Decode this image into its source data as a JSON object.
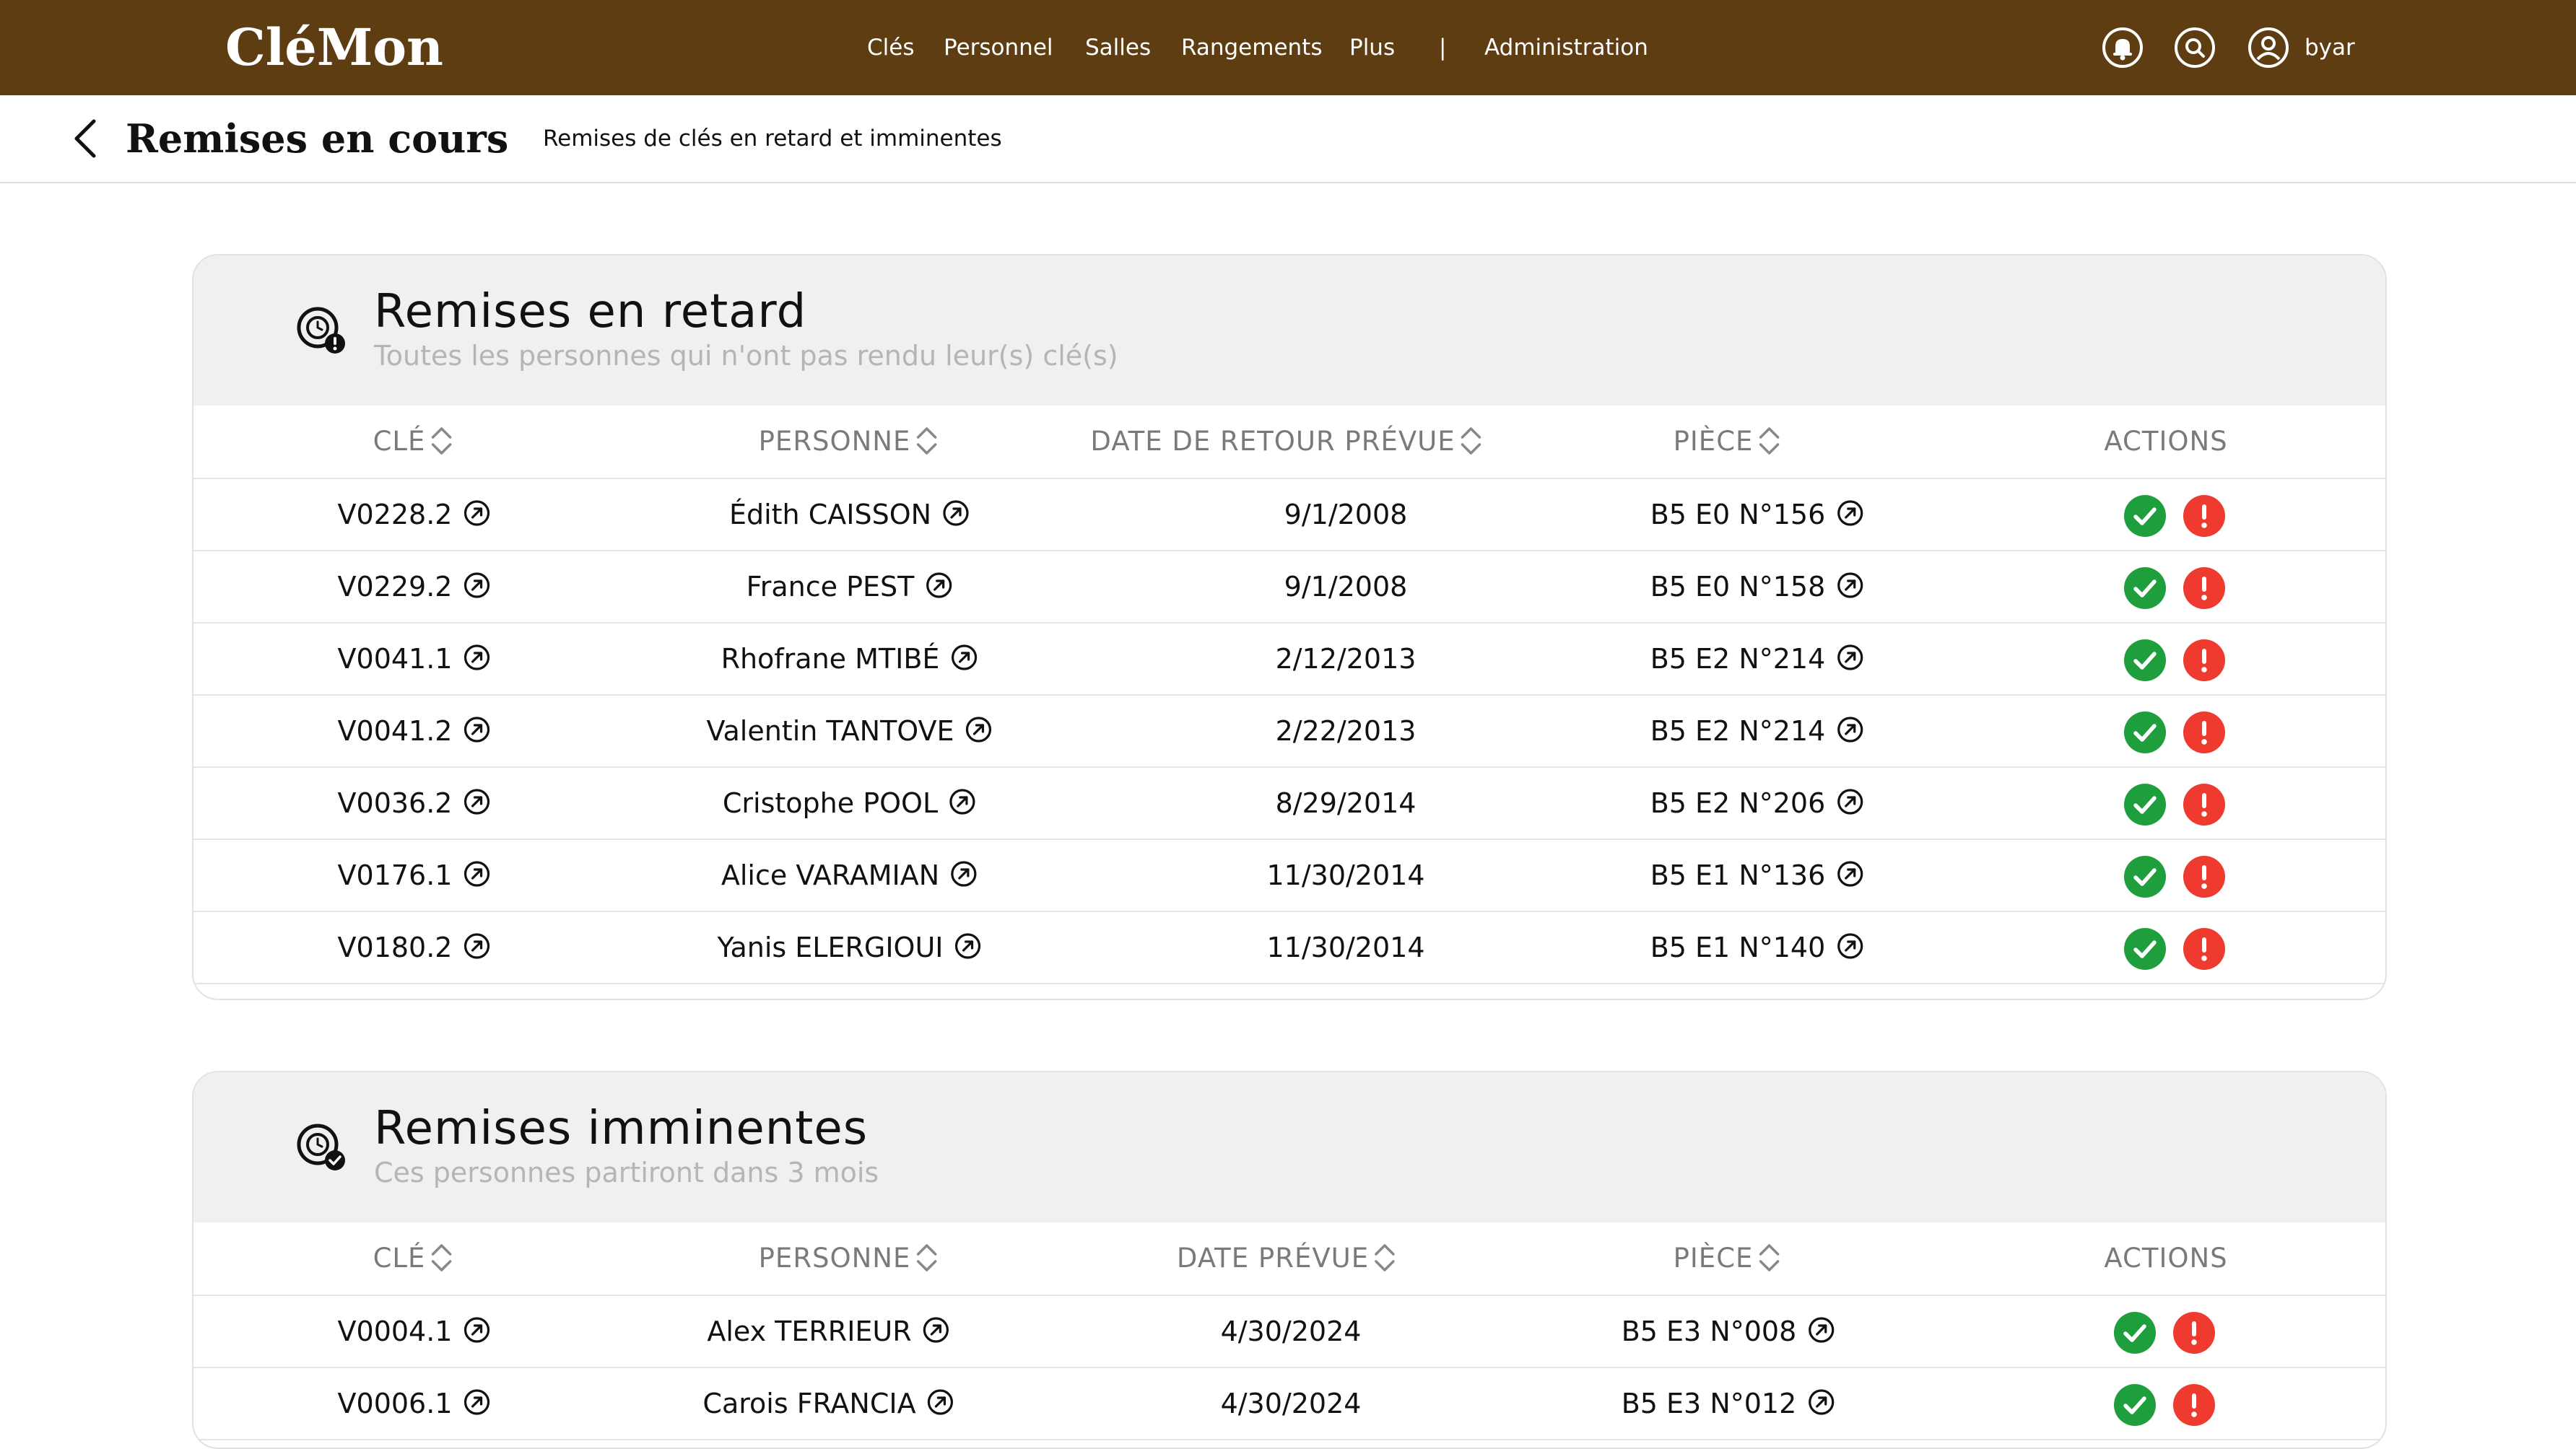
{
  "app": {
    "brand": "CléMon",
    "username": "byar"
  },
  "nav": {
    "items": [
      "Clés",
      "Personnel",
      "Salles",
      "Rangements",
      "Plus"
    ],
    "separator": "|",
    "admin": "Administration"
  },
  "page": {
    "title": "Remises en cours",
    "subtitle": "Remises de clés en retard et imminentes"
  },
  "colors": {
    "topbar": "#5e3d12",
    "validate": "#1e9e3c",
    "alert": "#ef3b2f"
  },
  "retard": {
    "title": "Remises en retard",
    "subtitle": "Toutes les personnes qui n'ont pas rendu leur(s) clé(s)",
    "columns": [
      "CLÉ",
      "PERSONNE",
      "DATE DE RETOUR PRÉVUE",
      "PIÈCE",
      "ACTIONS"
    ],
    "rows": [
      {
        "cle": "V0228.2",
        "personne": "Édith CAISSON",
        "date": "9/1/2008",
        "piece": "B5 E0 N°156"
      },
      {
        "cle": "V0229.2",
        "personne": "France PEST",
        "date": "9/1/2008",
        "piece": "B5 E0 N°158"
      },
      {
        "cle": "V0041.1",
        "personne": "Rhofrane MTIBÉ",
        "date": "2/12/2013",
        "piece": "B5 E2 N°214"
      },
      {
        "cle": "V0041.2",
        "personne": "Valentin TANTOVE",
        "date": "2/22/2013",
        "piece": "B5 E2 N°214"
      },
      {
        "cle": "V0036.2",
        "personne": "Cristophe POOL",
        "date": "8/29/2014",
        "piece": "B5 E2 N°206"
      },
      {
        "cle": "V0176.1",
        "personne": "Alice VARAMIAN",
        "date": "11/30/2014",
        "piece": "B5 E1 N°136"
      },
      {
        "cle": "V0180.2",
        "personne": "Yanis ELERGIOUI",
        "date": "11/30/2014",
        "piece": "B5 E1 N°140"
      }
    ]
  },
  "imminentes": {
    "title": "Remises imminentes",
    "subtitle": "Ces personnes partiront dans 3 mois",
    "columns": [
      "CLÉ",
      "PERSONNE",
      "DATE PRÉVUE",
      "PIÈCE",
      "ACTIONS"
    ],
    "rows": [
      {
        "cle": "V0004.1",
        "personne": "Alex TERRIEUR",
        "date": "4/30/2024",
        "piece": "B5 E3 N°008"
      },
      {
        "cle": "V0006.1",
        "personne": "Carois FRANCIA",
        "date": "4/30/2024",
        "piece": "B5 E3 N°012"
      }
    ]
  }
}
